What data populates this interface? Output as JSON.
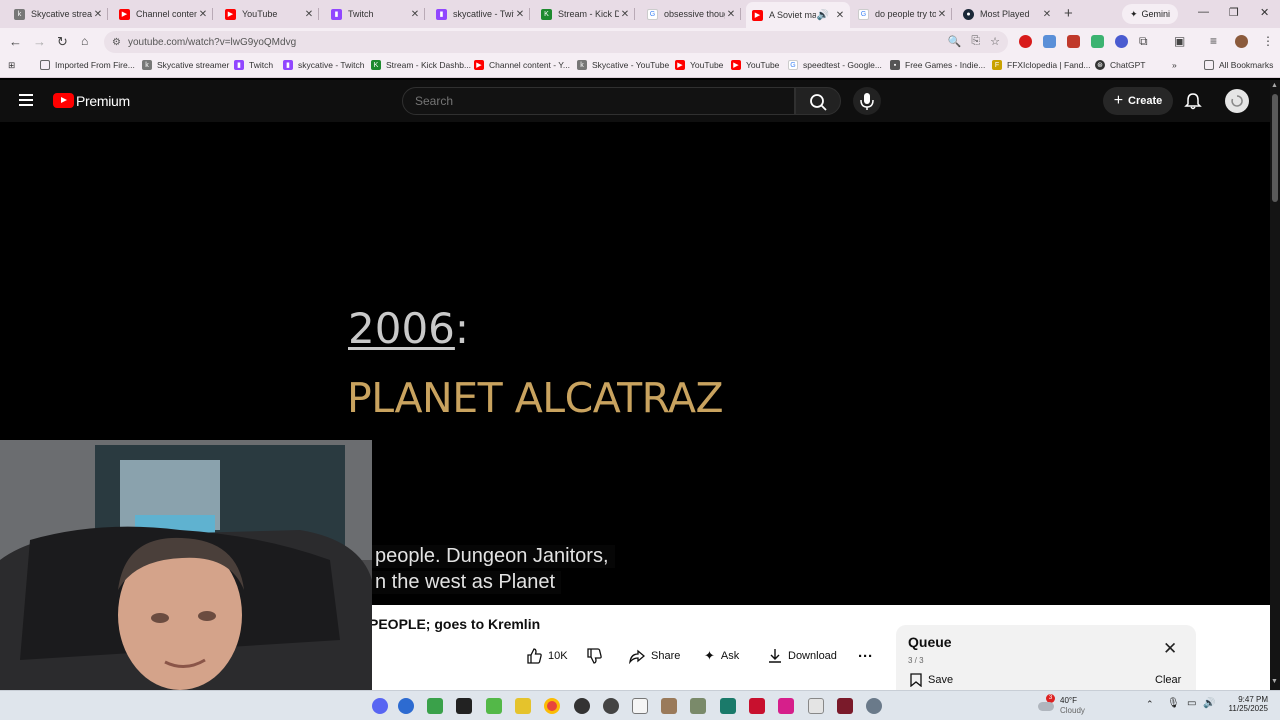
{
  "browser": {
    "tabs": [
      {
        "title": "Skycative streamer",
        "favicon": "k",
        "color": "#555555"
      },
      {
        "title": "Channel content - YouTube",
        "favicon": "yt",
        "color": "#ff0000"
      },
      {
        "title": "YouTube",
        "favicon": "yt",
        "color": "#ff0000"
      },
      {
        "title": "Twitch",
        "favicon": "tw",
        "color": "#9146ff"
      },
      {
        "title": "skycatlive - Twitch",
        "favicon": "tw",
        "color": "#9146ff"
      },
      {
        "title": "Stream - Kick Dashboard",
        "favicon": "kick",
        "color": "#1d8a2e"
      },
      {
        "title": "obsessive thoughts",
        "favicon": "g",
        "color": "#4285f4"
      },
      {
        "title": "A Soviet man",
        "favicon": "yt",
        "color": "#ff0000"
      },
      {
        "title": "do people try to",
        "favicon": "g",
        "color": "#4285f4"
      },
      {
        "title": "Most Played",
        "favicon": "steam",
        "color": "#1b2838"
      }
    ],
    "new_tab_label": "+",
    "gemini_label": "Gemini",
    "url": "youtube.com/watch?v=lwG9yoQMdvg",
    "bookmarks": [
      {
        "label": "Imported From Fire...",
        "icon": "folder-icon",
        "color": "#666666"
      },
      {
        "label": "Skycative streamer",
        "icon": "k",
        "color": "#555555"
      },
      {
        "label": "Twitch",
        "icon": "tw",
        "color": "#9146ff"
      },
      {
        "label": "skycative - Twitch",
        "icon": "tw",
        "color": "#9146ff"
      },
      {
        "label": "Stream - Kick Dashb...",
        "icon": "kick",
        "color": "#1d8a2e"
      },
      {
        "label": "Channel content - Y...",
        "icon": "yt",
        "color": "#ff0000"
      },
      {
        "label": "Skycative - YouTube",
        "icon": "k",
        "color": "#555555"
      },
      {
        "label": "YouTube",
        "icon": "yt",
        "color": "#ff0000"
      },
      {
        "label": "YouTube",
        "icon": "yt",
        "color": "#ff0000"
      },
      {
        "label": "speedtest - Google...",
        "icon": "g",
        "color": "#4285f4"
      },
      {
        "label": "Free Games - Indie...",
        "icon": "game",
        "color": "#555555"
      },
      {
        "label": "FFXIclopedia | Fand...",
        "icon": "fandom",
        "color": "#c9a100"
      },
      {
        "label": "ChatGPT",
        "icon": "gpt",
        "color": "#333333"
      }
    ],
    "all_bookmarks_label": "All Bookmarks"
  },
  "youtube": {
    "logo_text": "Premium",
    "search_placeholder": "Search",
    "create_label": "Create",
    "video": {
      "year_text": "2006",
      "year_suffix": ":",
      "title_card": "PLANET ALCATRAZ",
      "caption_line1": "people. Dungeon Janitors,",
      "caption_line2": "n the west as Planet"
    },
    "video_title": "PEOPLE; goes to Kremlin",
    "actions": {
      "like_count": "10K",
      "share_label": "Share",
      "ask_label": "Ask",
      "download_label": "Download"
    },
    "queue": {
      "title": "Queue",
      "count": "3 / 3",
      "save_label": "Save",
      "clear_label": "Clear"
    }
  },
  "taskbar": {
    "weather_temp": "40°F",
    "weather_desc": "Cloudy",
    "weather_badge": "3",
    "time": "9:47 PM",
    "date": "11/25/2025"
  }
}
